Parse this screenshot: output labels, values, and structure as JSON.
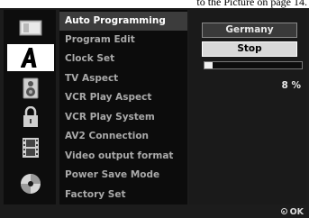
{
  "caption": "to the Picture on page 14.",
  "icons": [
    {
      "name": "monitor-icon",
      "active": false
    },
    {
      "name": "language-a-icon",
      "active": true
    },
    {
      "name": "speaker-icon",
      "active": false
    },
    {
      "name": "lock-icon",
      "active": false
    },
    {
      "name": "film-icon",
      "active": false
    },
    {
      "name": "disc-icon",
      "active": false
    }
  ],
  "menu": [
    {
      "label": "Auto Programming",
      "selected": true
    },
    {
      "label": "Program Edit"
    },
    {
      "label": "Clock Set"
    },
    {
      "label": "TV Aspect"
    },
    {
      "label": "VCR Play Aspect"
    },
    {
      "label": "VCR Play System"
    },
    {
      "label": "AV2 Connection"
    },
    {
      "label": "Video output format"
    },
    {
      "label": "Power Save Mode"
    },
    {
      "label": "Factory Set"
    }
  ],
  "panel": {
    "country": "Germany",
    "stop": "Stop",
    "progress_fraction": 0.08,
    "progress_label": "8 %"
  },
  "footer": {
    "ok_label": "OK"
  }
}
